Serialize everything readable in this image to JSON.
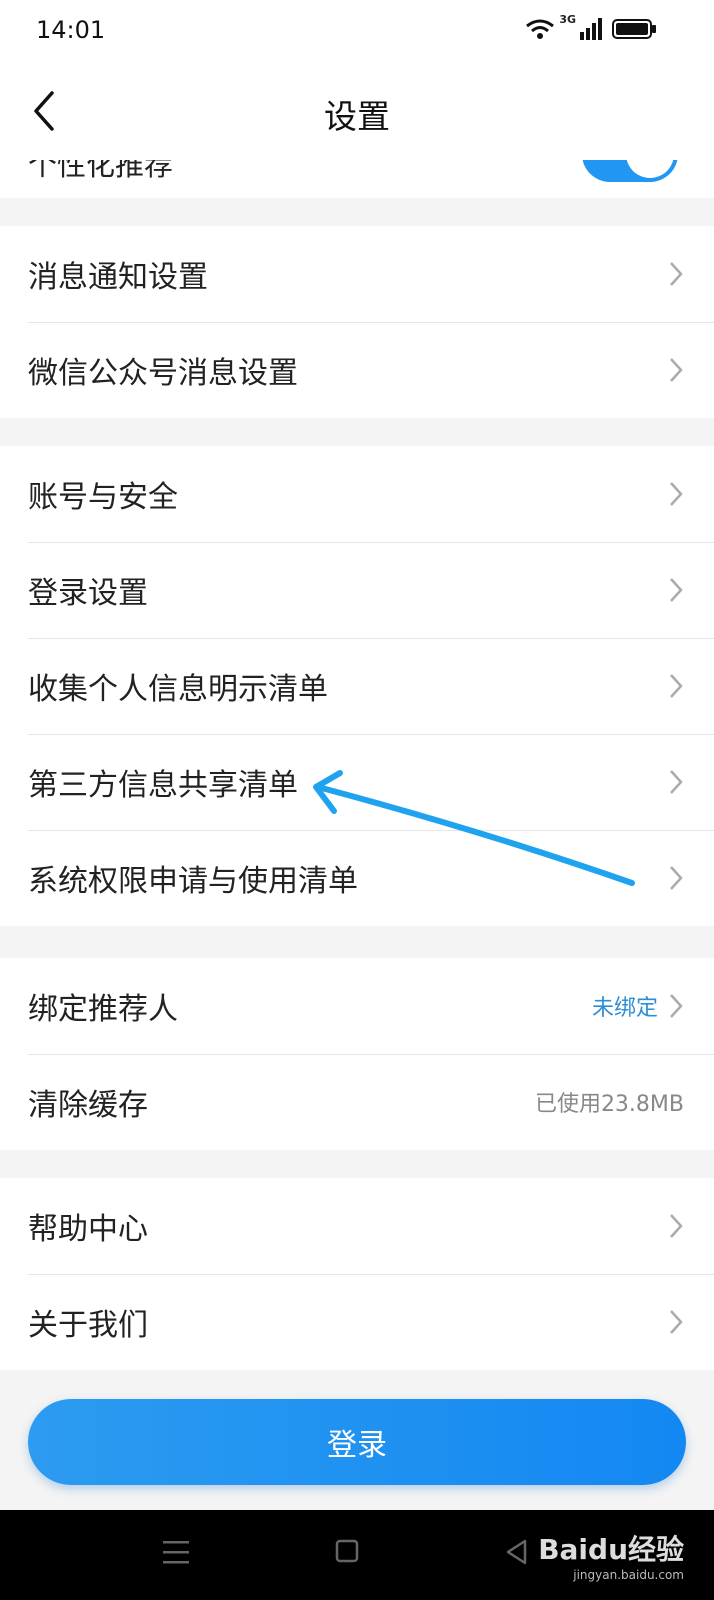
{
  "status_bar": {
    "time": "14:01",
    "network": "3G"
  },
  "header": {
    "title": "设置"
  },
  "partial_row": {
    "label": "个性化推荐",
    "toggle_on": true
  },
  "groups": [
    {
      "items": [
        {
          "label": "消息通知设置"
        },
        {
          "label": "微信公众号消息设置"
        }
      ]
    },
    {
      "items": [
        {
          "label": "账号与安全"
        },
        {
          "label": "登录设置"
        },
        {
          "label": "收集个人信息明示清单"
        },
        {
          "label": "第三方信息共享清单"
        },
        {
          "label": "系统权限申请与使用清单"
        }
      ]
    },
    {
      "items": [
        {
          "label": "绑定推荐人",
          "value": "未绑定",
          "value_color": "#2c8ed6"
        },
        {
          "label": "清除缓存",
          "value": "已使用23.8MB"
        }
      ]
    },
    {
      "items": [
        {
          "label": "帮助中心"
        },
        {
          "label": "关于我们"
        }
      ]
    }
  ],
  "login_button": {
    "label": "登录"
  },
  "watermark": {
    "brand": "Baidu经验",
    "url": "jingyan.baidu.com"
  },
  "colors": {
    "accent": "#2196f3",
    "button": "#1b8ff1",
    "annotation_arrow": "#1fa3ef"
  }
}
